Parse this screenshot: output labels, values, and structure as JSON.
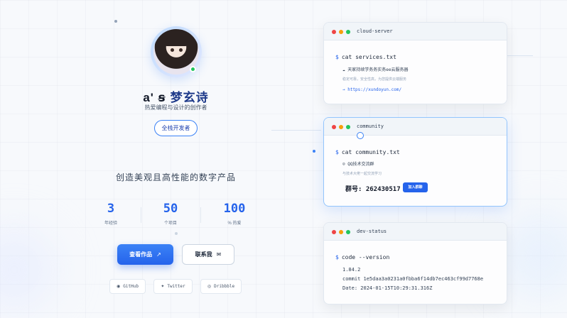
{
  "profile": {
    "alias": "a' ꞩ",
    "name": "梦玄诗",
    "bio": "热爱编程与设计的创作者",
    "role": "全栈开发者",
    "tagline": "创造美观且高性能的数字产品"
  },
  "stats": [
    {
      "value": "3",
      "label": "年经验"
    },
    {
      "value": "50",
      "label": "个项目"
    },
    {
      "value": "100",
      "label": "% 热爱"
    }
  ],
  "actions": {
    "primary": {
      "label": "查看作品",
      "icon": "arrow-up-right-icon"
    },
    "secondary": {
      "label": "联系我",
      "icon": "mail-icon"
    }
  },
  "social": [
    {
      "label": "GitHub",
      "icon": "github-icon"
    },
    {
      "label": "Twitter",
      "icon": "twitter-icon"
    },
    {
      "label": "Dribbble",
      "icon": "dribbble-icon"
    }
  ],
  "terminals": {
    "cloud": {
      "title": "cloud-server",
      "command": "cat services.txt",
      "line1": "☁ 天家持续学务务实务ee云服务器",
      "line2": "稳定可靠，安全性高，为您提供云端服务",
      "link": "→ https://xundoyun.com/"
    },
    "community": {
      "title": "community",
      "command": "cat community.txt",
      "line1": "☺ QQ技术交流群",
      "line2": "与技术大佬一起交流学习",
      "group_label": "群号:",
      "group_number": "262430517",
      "join": "加入群聊"
    },
    "status": {
      "title": "dev-status",
      "command": "code --version",
      "version": "1.84.2",
      "commit": "commit 1e5daa3a0231a0fbba6f14db7ec463cf99d7768e",
      "date": "Date: 2024-01-15T10:29:31.316Z"
    }
  },
  "colors": {
    "accent": "#2563eb",
    "online": "#22c55e"
  }
}
